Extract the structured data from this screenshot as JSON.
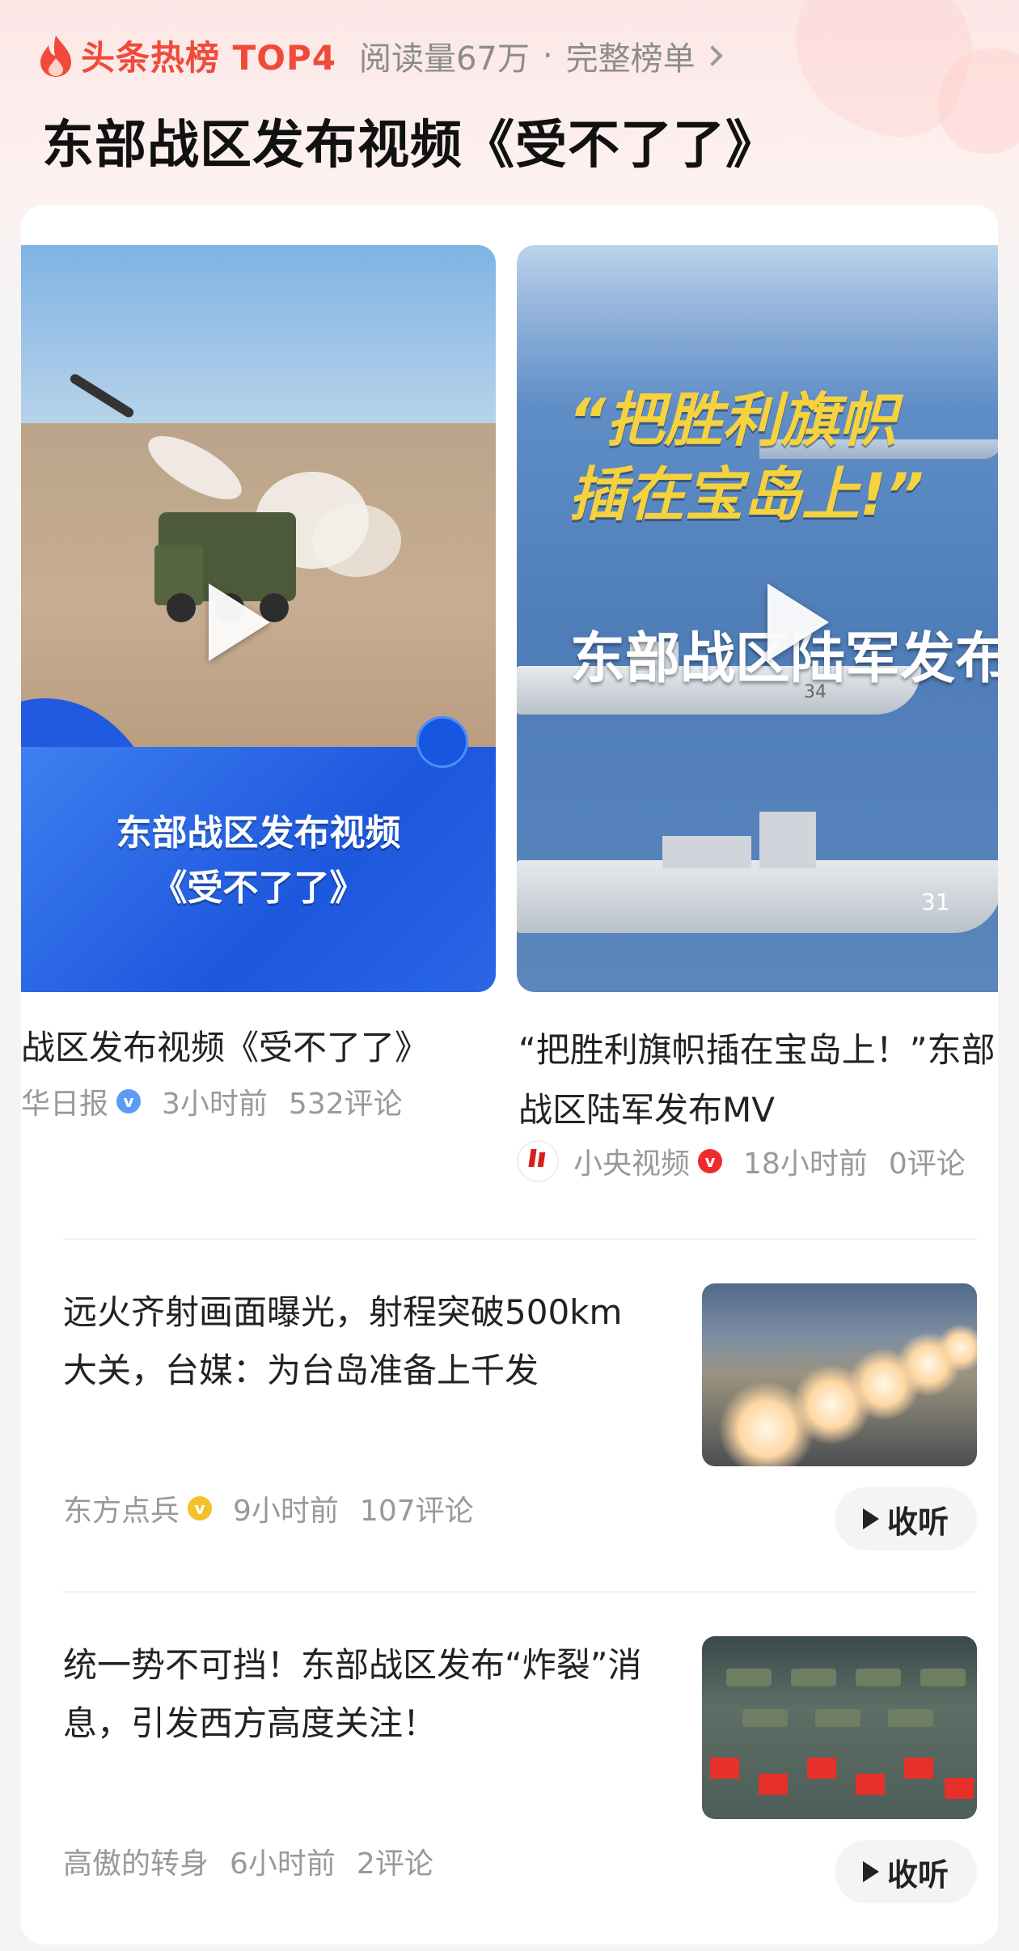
{
  "header": {
    "hot_rank": "头条热榜 TOP4",
    "reads": "阅读量67万",
    "dot": "·",
    "full_list": "完整榜单",
    "title": "东部战区发布视频《受不了了》"
  },
  "videos": [
    {
      "overlay_line1": "东部战区发布视频",
      "overlay_line2": "《受不了了》",
      "title": "战区发布视频《受不了了》",
      "source": "华日报",
      "time": "3小时前",
      "comments": "532评论"
    },
    {
      "quote_line1": "“把胜利旗帜",
      "quote_line2": "插在宝岛上!”",
      "overlay": "东部战区陆军发布MV",
      "hull1": "34",
      "hull2": "31",
      "title": "“把胜利旗帜插在宝岛上！”东部战区陆军发布MV",
      "source": "小央视频",
      "time": "18小时前",
      "comments": "0评论"
    }
  ],
  "news": [
    {
      "title": "远火齐射画面曝光，射程突破500km大关，台媒：为台岛准备上千发",
      "source": "东方点兵",
      "time": "9小时前",
      "comments": "107评论",
      "listen": "收听"
    },
    {
      "title": "统一势不可挡！东部战区发布“炸裂”消息，引发西方高度关注！",
      "source": "高傲的转身",
      "time": "6小时前",
      "comments": "2评论",
      "listen": "收听"
    }
  ],
  "badges": {
    "v": "v"
  },
  "colors": {
    "accent": "#f04a3a",
    "blue_badge": "#5a9bf5",
    "red_badge": "#ee2a2a",
    "yellow_badge": "#f3c12a"
  }
}
